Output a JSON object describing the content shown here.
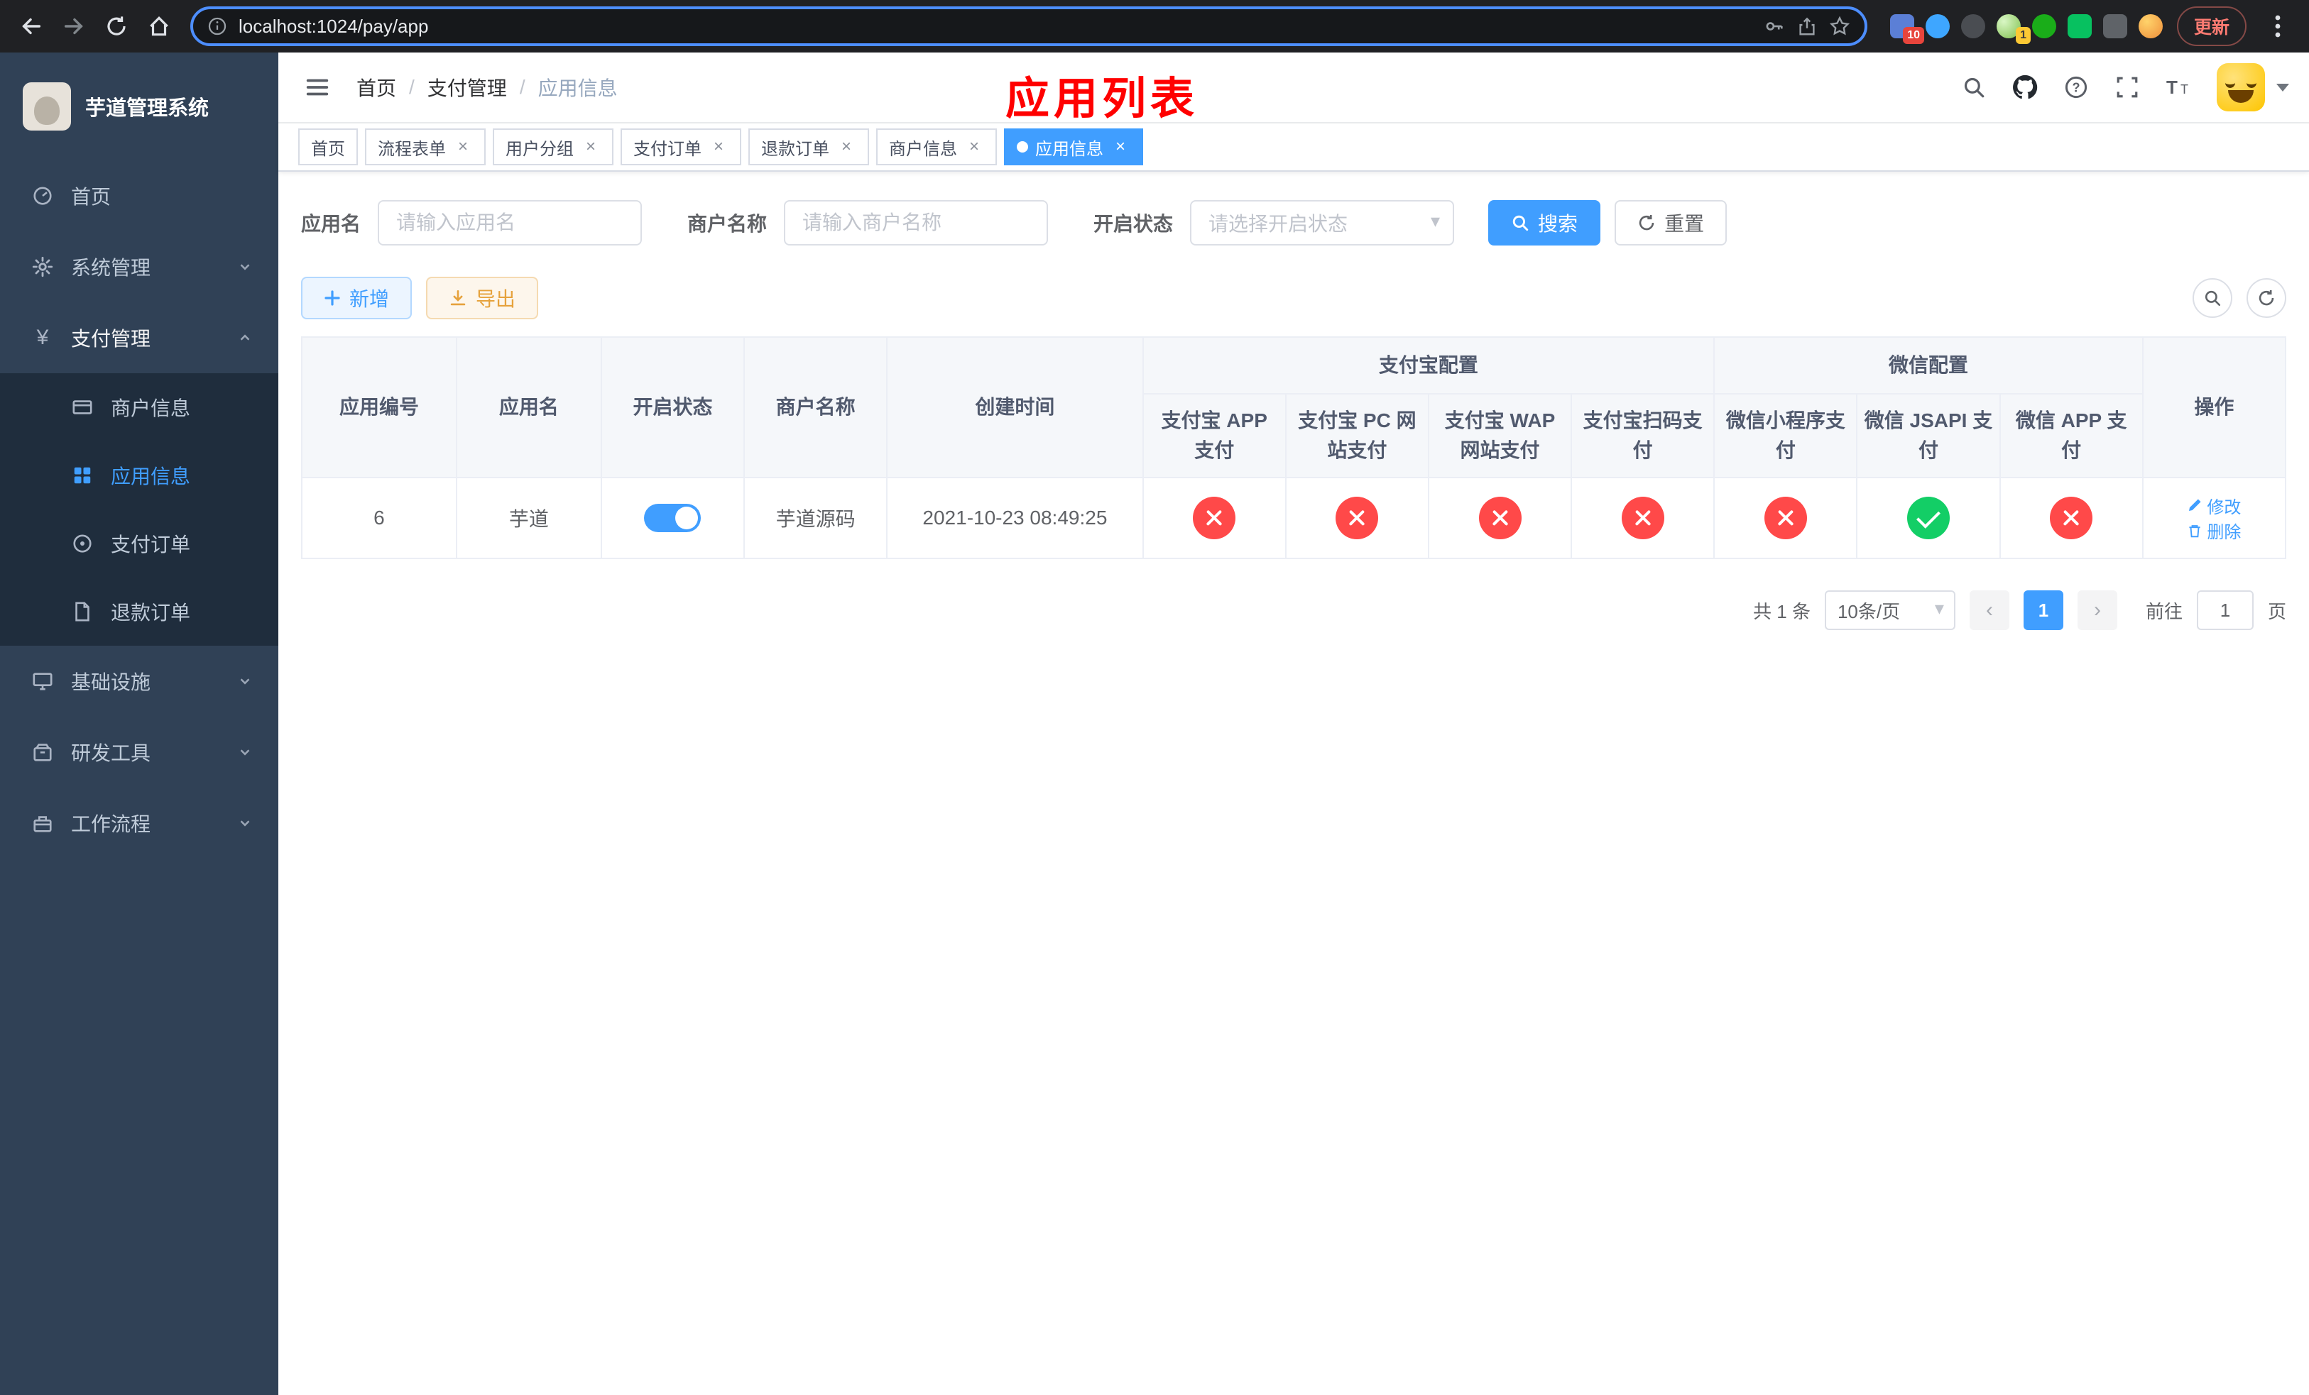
{
  "browser": {
    "url": "localhost:1024/pay/app",
    "update_label": "更新",
    "ext_badge_red": "10",
    "ext_badge_yellow": "1"
  },
  "annotation": "应用列表",
  "sidebar": {
    "title": "芋道管理系统",
    "items": {
      "home": "首页",
      "system": "系统管理",
      "payment": "支付管理",
      "infra": "基础设施",
      "devtools": "研发工具",
      "workflow": "工作流程"
    },
    "payment_children": [
      "商户信息",
      "应用信息",
      "支付订单",
      "退款订单"
    ]
  },
  "breadcrumb": [
    "首页",
    "支付管理",
    "应用信息"
  ],
  "tabs": [
    "首页",
    "流程表单",
    "用户分组",
    "支付订单",
    "退款订单",
    "商户信息",
    "应用信息"
  ],
  "filters": {
    "app_name_label": "应用名",
    "app_name_placeholder": "请输入应用名",
    "merchant_label": "商户名称",
    "merchant_placeholder": "请输入商户名称",
    "status_label": "开启状态",
    "status_placeholder": "请选择开启状态",
    "search": "搜索",
    "reset": "重置"
  },
  "toolbar": {
    "add": "新增",
    "export": "导出"
  },
  "table": {
    "headers": {
      "app_id": "应用编号",
      "app_name": "应用名",
      "status": "开启状态",
      "merchant": "商户名称",
      "created": "创建时间",
      "alipay_group": "支付宝配置",
      "wechat_group": "微信配置",
      "alipay_app": "支付宝 APP 支付",
      "alipay_pc": "支付宝 PC 网站支付",
      "alipay_wap": "支付宝 WAP 网站支付",
      "alipay_qr": "支付宝扫码支付",
      "wx_mini": "微信小程序支付",
      "wx_jsapi": "微信 JSAPI 支付",
      "wx_app": "微信 APP 支付",
      "actions": "操作"
    },
    "rows": [
      {
        "id": "6",
        "name": "芋道",
        "enabled": true,
        "merchant": "芋道源码",
        "created": "2021-10-23 08:49:25",
        "configs": [
          false,
          false,
          false,
          false,
          false,
          true,
          false
        ],
        "edit": "修改",
        "delete": "删除"
      }
    ]
  },
  "pagination": {
    "total": "共 1 条",
    "page_size": "10条/页",
    "page": "1",
    "goto_label": "前往",
    "goto_value": "1",
    "goto_unit": "页"
  },
  "icons": {
    "close": "×",
    "dropdown_caret": "▾",
    "prev": "‹",
    "next": "›",
    "yen": "¥"
  }
}
